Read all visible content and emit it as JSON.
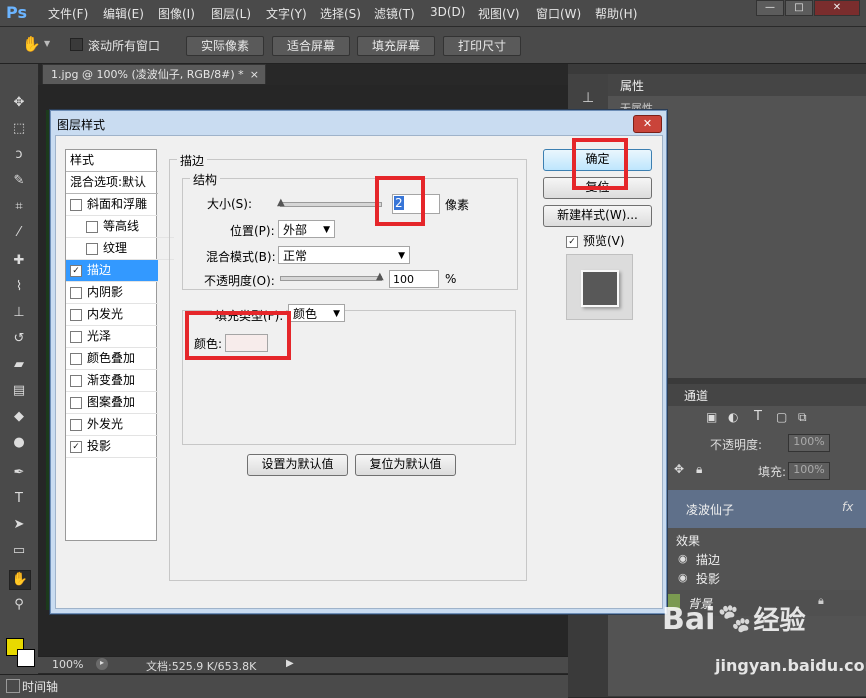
{
  "menubar": {
    "logo": "Ps",
    "items": [
      "文件(F)",
      "编辑(E)",
      "图像(I)",
      "图层(L)",
      "文字(Y)",
      "选择(S)",
      "滤镜(T)",
      "3D(D)",
      "视图(V)",
      "窗口(W)",
      "帮助(H)"
    ]
  },
  "optbar": {
    "scroll_all": "滚动所有窗口",
    "buttons": [
      "实际像素",
      "适合屏幕",
      "填充屏幕",
      "打印尺寸"
    ]
  },
  "document": {
    "tab_label": "1.jpg @ 100% (凌波仙子, RGB/8#) *",
    "close": "×"
  },
  "status": {
    "zoom": "100%",
    "doc_info": "文档:525.9 K/653.8K",
    "timeline": "时间轴"
  },
  "right_panel": {
    "properties_tab": "属性",
    "properties_sub": "无属性",
    "channels_tab": "通道",
    "opacity_label": "不透明度:",
    "opacity_value": "100%",
    "fill_label": "填充:",
    "fill_value": "100%",
    "layer_name": "凌波仙子",
    "fx": "fx",
    "effects_label": "效果",
    "effect_stroke": "描边",
    "effect_shadow": "投影",
    "background_layer": "背景"
  },
  "dialog": {
    "title": "图层样式",
    "close": "✕",
    "styles_header": "样式",
    "blend_options": "混合选项:默认",
    "styles": [
      {
        "label": "斜面和浮雕",
        "checked": false,
        "indent": false
      },
      {
        "label": "等高线",
        "checked": false,
        "indent": true
      },
      {
        "label": "纹理",
        "checked": false,
        "indent": true
      },
      {
        "label": "描边",
        "checked": true,
        "indent": false,
        "selected": true
      },
      {
        "label": "内阴影",
        "checked": false,
        "indent": false
      },
      {
        "label": "内发光",
        "checked": false,
        "indent": false
      },
      {
        "label": "光泽",
        "checked": false,
        "indent": false
      },
      {
        "label": "颜色叠加",
        "checked": false,
        "indent": false
      },
      {
        "label": "渐变叠加",
        "checked": false,
        "indent": false
      },
      {
        "label": "图案叠加",
        "checked": false,
        "indent": false
      },
      {
        "label": "外发光",
        "checked": false,
        "indent": false
      },
      {
        "label": "投影",
        "checked": true,
        "indent": false
      }
    ],
    "section_title": "描边",
    "structure_title": "结构",
    "size_label": "大小(S):",
    "size_value": "2",
    "size_unit": "像素",
    "position_label": "位置(P):",
    "position_value": "外部",
    "blend_mode_label": "混合模式(B):",
    "blend_mode_value": "正常",
    "opacity_label": "不透明度(O):",
    "opacity_value": "100",
    "opacity_unit": "%",
    "fill_type_label": "填充类型(F):",
    "fill_type_value": "颜色",
    "color_label": "颜色:",
    "stroke_color": "#f7eceb",
    "btn_set_default": "设置为默认值",
    "btn_reset_default": "复位为默认值",
    "btn_ok": "确定",
    "btn_reset": "复位",
    "btn_new_style": "新建样式(W)...",
    "preview_label": "预览(V)",
    "preview_checked": true
  },
  "watermark": {
    "brand": "Bai",
    "brand2": "经验",
    "url": "jingyan.baidu.com"
  }
}
